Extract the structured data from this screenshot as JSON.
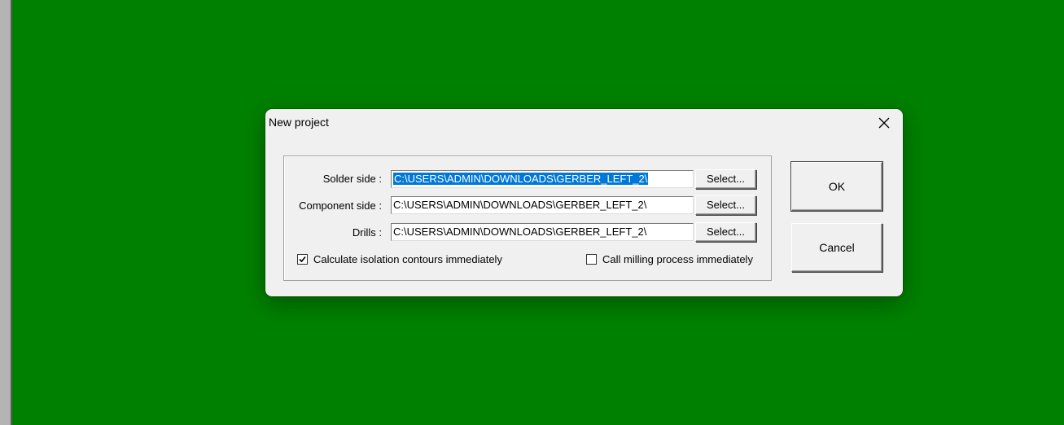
{
  "background": {
    "desktop_color": "#008000",
    "left_strip_color": "#b4b4b4"
  },
  "dialog": {
    "title": "New project",
    "close_icon": "close-icon",
    "rows": [
      {
        "label": "Solder side :",
        "value": "C:\\USERS\\ADMIN\\DOWNLOADS\\GERBER_LEFT_2\\",
        "selected": true,
        "button": "Select..."
      },
      {
        "label": "Component side :",
        "value": "C:\\USERS\\ADMIN\\DOWNLOADS\\GERBER_LEFT_2\\",
        "selected": false,
        "button": "Select..."
      },
      {
        "label": "Drills :",
        "value": "C:\\USERS\\ADMIN\\DOWNLOADS\\GERBER_LEFT_2\\",
        "selected": false,
        "button": "Select..."
      }
    ],
    "checkboxes": [
      {
        "label": "Calculate isolation contours immediately",
        "checked": true
      },
      {
        "label": "Call milling process immediately",
        "checked": false
      }
    ],
    "ok_label": "OK",
    "cancel_label": "Cancel",
    "selection_color": "#0078d7"
  }
}
